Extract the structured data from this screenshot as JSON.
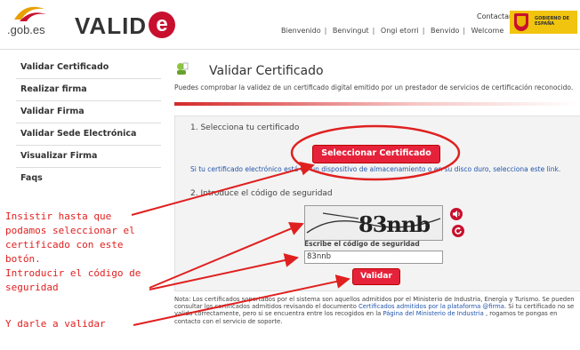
{
  "header": {
    "logo_text": ".gob.es",
    "brand": "VALID",
    "brand_e": "e",
    "contact": "Contactar",
    "nav": [
      "Bienvenido",
      "Benvingut",
      "Ongi etorri",
      "Benvido",
      "Welcome"
    ],
    "gobierno": "GOBIERNO DE ESPAÑA"
  },
  "sidebar": {
    "items": [
      {
        "label": "Validar Certificado"
      },
      {
        "label": "Realizar firma"
      },
      {
        "label": "Validar Firma"
      },
      {
        "label": "Validar Sede Electrónica"
      },
      {
        "label": "Visualizar Firma"
      },
      {
        "label": "Faqs"
      }
    ]
  },
  "main": {
    "title": "Validar Certificado",
    "description": "Puedes comprobar la validez de un certificado digital emitido por un prestador de servicios de certificación reconocido.",
    "step1": "1. Selecciona tu certificado",
    "select_button": "Seleccionar Certificado",
    "info": "Si tu certificado electrónico está en un dispositivo de almacenamiento o en su disco duro, selecciona este link.",
    "step2": "2. Introduce el código de seguridad",
    "captcha_text": "83nnb",
    "security_label": "Escribe el código de seguridad",
    "security_value": "83nnb",
    "validate_button": "Validar",
    "note_part1": "Nota: Los certificados soportados por el sistema son aquellos admitidos por el Ministerio de Industria, Energía y Turismo. Se pueden consultar los certificados admitidos revisando el documento ",
    "note_link1": "Certificados admitidos por la plataforma @firma",
    "note_part2": ". Si tu certificado no se valida correctamente, pero si se encuentra entre los recogidos en la ",
    "note_link2": "Página del Ministerio de Industria",
    "note_part3": " , rogamos te pongas en contacto con el servicio de soporte."
  },
  "annotations": {
    "line1": "Insistir hasta que",
    "line2": "podamos seleccionar el",
    "line3": "certificado con este",
    "line4": "botón.",
    "line5": "Introducir el código de",
    "line6": "seguridad",
    "line7": "Y darle a validar"
  },
  "colors": {
    "accent": "#e6223b",
    "annotation": "#e02020",
    "link": "#2255aa"
  }
}
